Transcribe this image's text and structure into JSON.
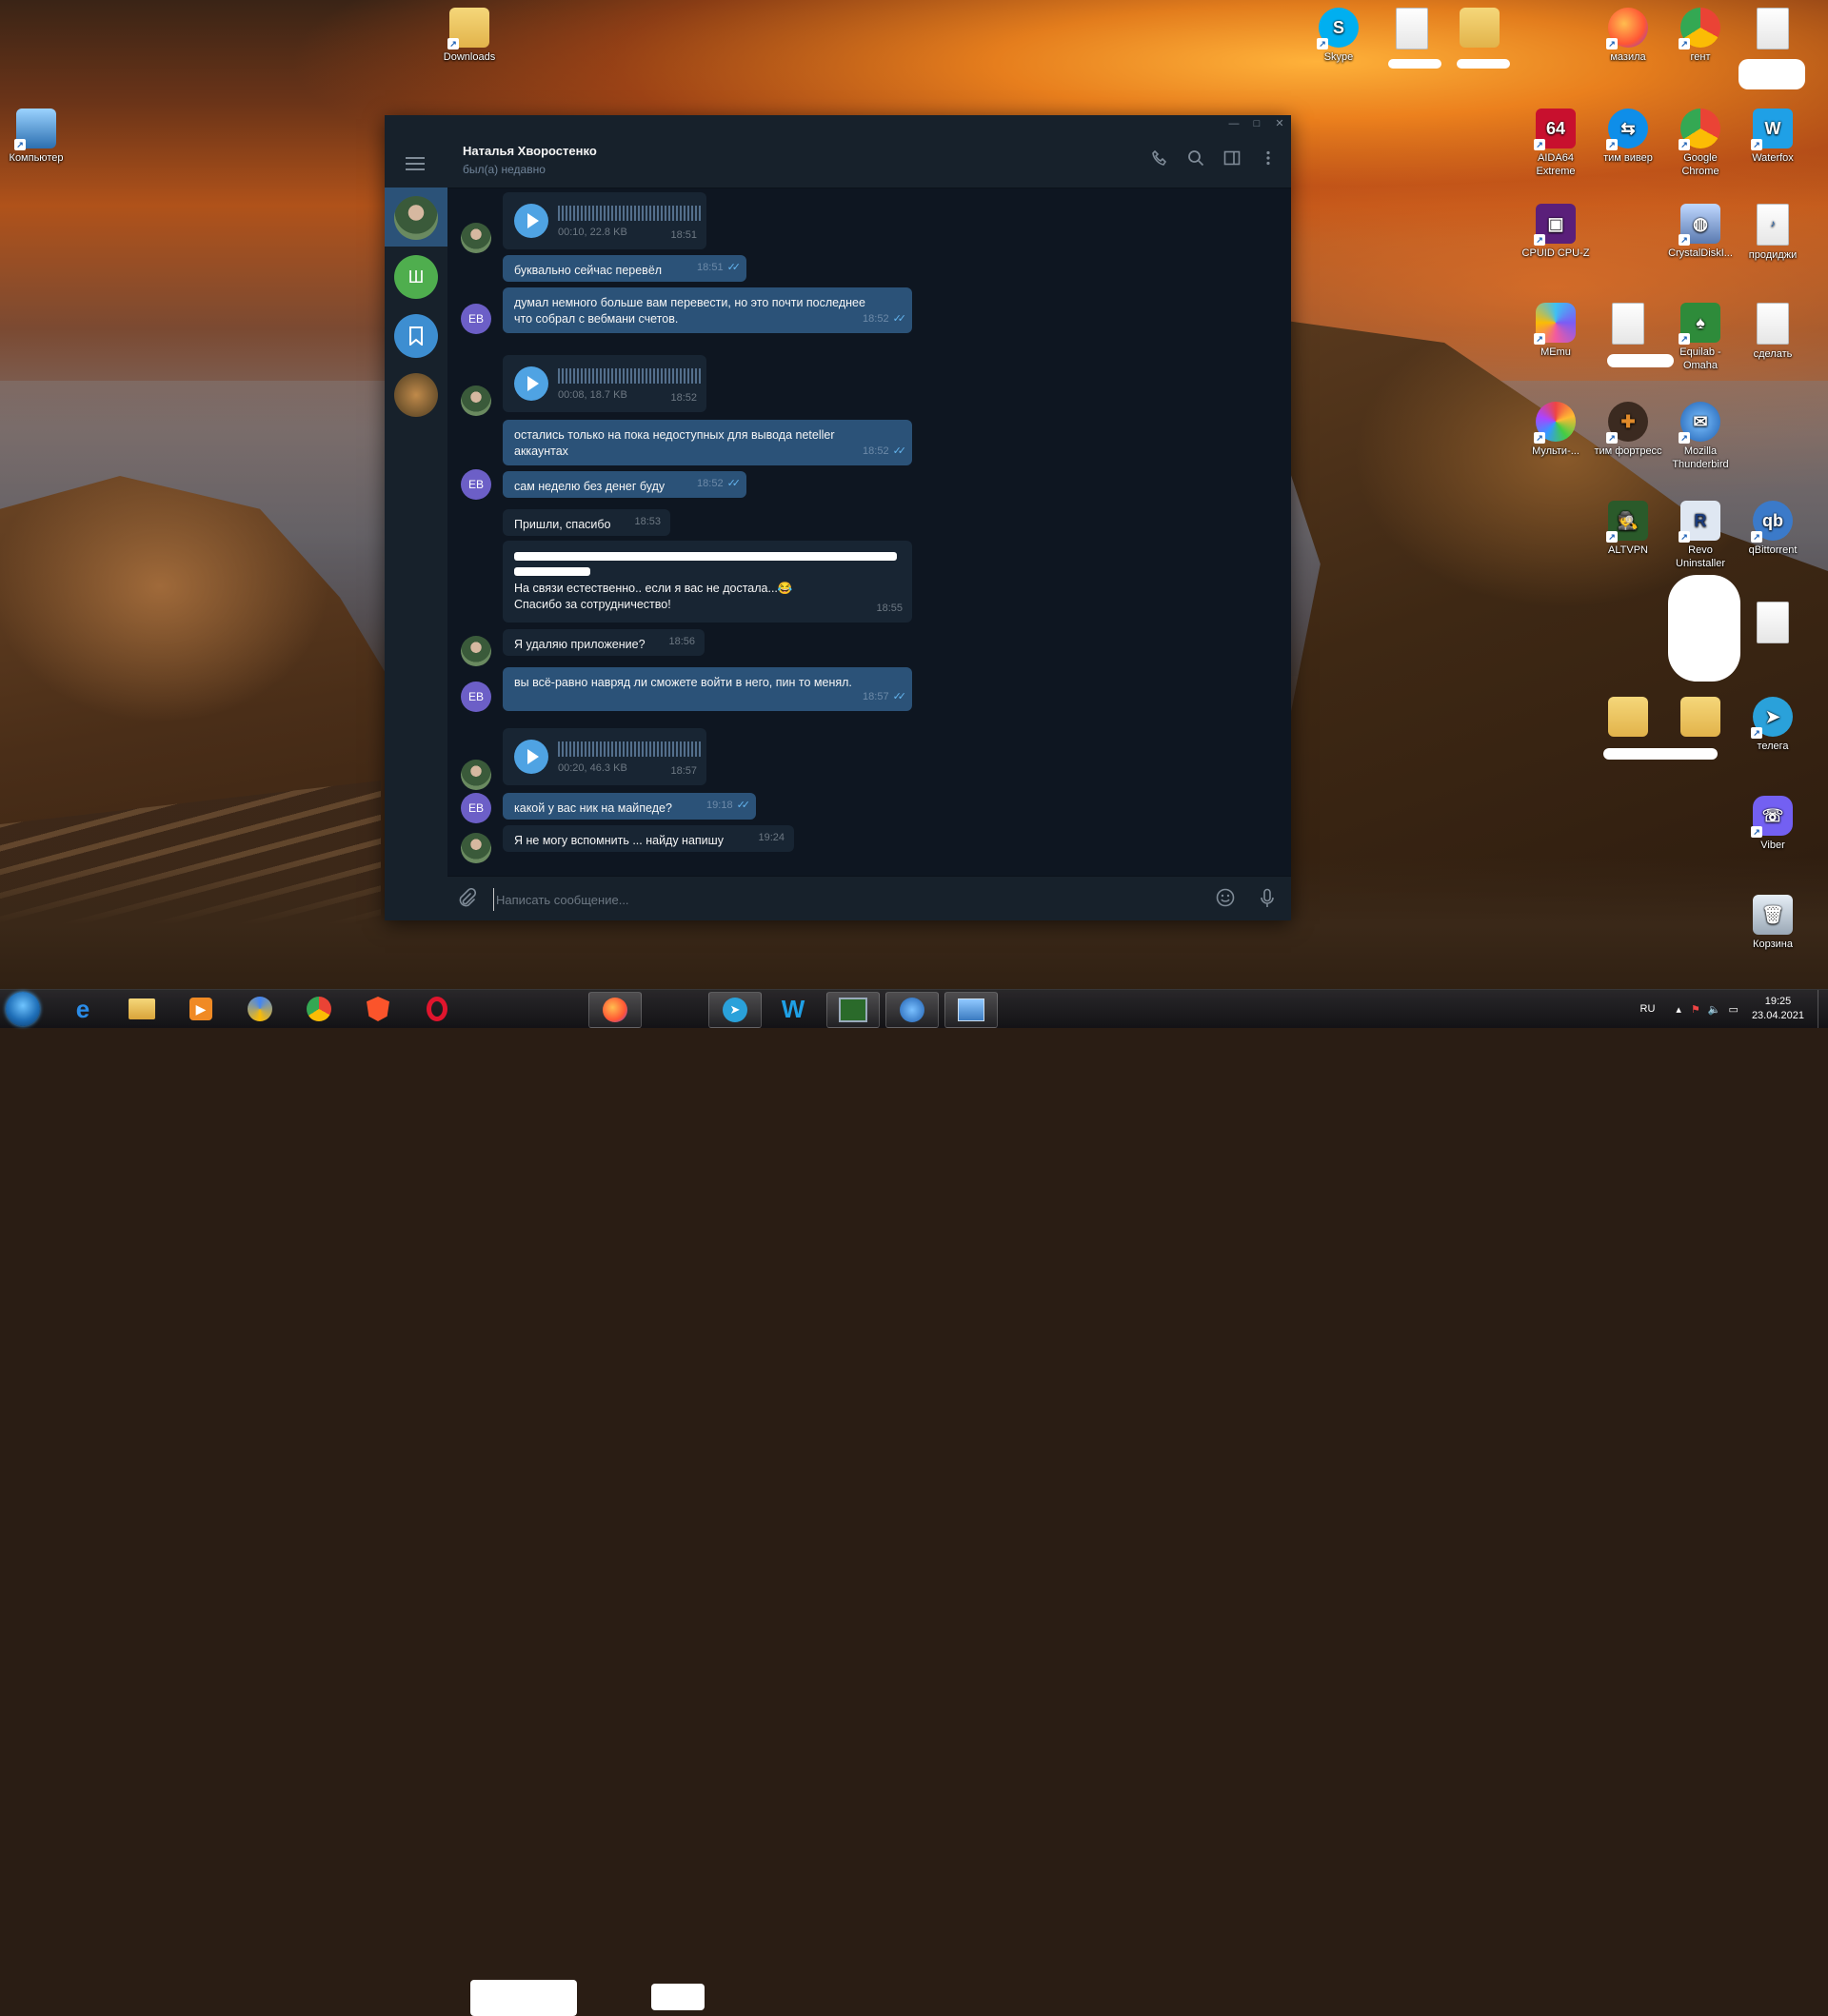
{
  "desktop": {
    "icons": [
      {
        "label": "Downloads",
        "icon": "folder-icon"
      },
      {
        "label": "Компьютер",
        "icon": "computer-icon"
      },
      {
        "label": "Skype",
        "icon": "skype-icon"
      },
      {
        "label": "мазила",
        "icon": "firefox-icon"
      },
      {
        "label": "гент",
        "icon": "chrome-icon"
      },
      {
        "label": "AIDA64 Extreme",
        "icon": "aida64-icon"
      },
      {
        "label": "тим вивер",
        "icon": "teamviewer-icon"
      },
      {
        "label": "Google Chrome",
        "icon": "chrome-icon"
      },
      {
        "label": "Waterfox",
        "icon": "waterfox-icon"
      },
      {
        "label": "CPUID CPU-Z",
        "icon": "cpuz-icon"
      },
      {
        "label": "CrystalDiskI...",
        "icon": "crystaldisk-icon"
      },
      {
        "label": "продиджи",
        "icon": "mp3-icon"
      },
      {
        "label": "MEmu",
        "icon": "memu-icon"
      },
      {
        "label": "Equilab - Omaha",
        "icon": "equilab-icon"
      },
      {
        "label": "сделать",
        "icon": "document-icon"
      },
      {
        "label": "Мульти-...",
        "icon": "multi-icon"
      },
      {
        "label": "тим фортресс",
        "icon": "tf2-icon"
      },
      {
        "label": "Mozilla Thunderbird",
        "icon": "thunderbird-icon"
      },
      {
        "label": "ALTVPN",
        "icon": "altvpn-icon"
      },
      {
        "label": "Revo Uninstaller",
        "icon": "revo-icon"
      },
      {
        "label": "qBittorrent",
        "icon": "qbittorrent-icon"
      },
      {
        "label": "телега",
        "icon": "telegram-icon"
      },
      {
        "label": "Viber",
        "icon": "viber-icon"
      },
      {
        "label": "Корзина",
        "icon": "recycle-bin-icon"
      }
    ]
  },
  "telegram": {
    "window_controls": [
      "—",
      "□",
      "✕"
    ],
    "contact_name": "Наталья Хворостенко",
    "contact_status": "был(а) недавно",
    "sidebar_chats": [
      {
        "initials": "",
        "icon": "avatar-photo"
      },
      {
        "initials": "Ш",
        "icon": "avatar-letter"
      },
      {
        "initials": "",
        "icon": "bookmark-icon"
      },
      {
        "initials": "",
        "icon": "avatar-photo"
      }
    ],
    "composer_placeholder": "Написать сообщение...",
    "messages": [
      {
        "type": "voice",
        "dir": "in",
        "meta": "00:10, 22.8 KB",
        "time": "18:51"
      },
      {
        "type": "text",
        "dir": "out",
        "text": "буквально сейчас перевёл",
        "time": "18:51"
      },
      {
        "type": "text",
        "dir": "out",
        "text": "думал немного больше вам перевести, но это почти последнее\nчто собрал с вебмани счетов.",
        "time": "18:52"
      },
      {
        "type": "voice",
        "dir": "in",
        "meta": "00:08, 18.7 KB",
        "time": "18:52"
      },
      {
        "type": "text",
        "dir": "out",
        "text": "остались только на пока недоступных для вывода neteller\nаккаунтах",
        "time": "18:52"
      },
      {
        "type": "text",
        "dir": "out",
        "text": "сам неделю без денег буду",
        "time": "18:52"
      },
      {
        "type": "text",
        "dir": "in",
        "text": "Пришли, спасибо",
        "time": "18:53"
      },
      {
        "type": "text",
        "dir": "in",
        "text": "На связи естественно.. если я вас не достала...😂\nСпасибо за сотрудничество!",
        "time": "18:55"
      },
      {
        "type": "text",
        "dir": "in",
        "text": "Я удаляю приложение?",
        "time": "18:56"
      },
      {
        "type": "text",
        "dir": "out",
        "text": "вы всё-равно навряд ли сможете войти в него, пин то менял.",
        "time": "18:57"
      },
      {
        "type": "voice",
        "dir": "in",
        "meta": "00:20, 46.3 KB",
        "time": "18:57"
      },
      {
        "type": "text",
        "dir": "out",
        "text": "какой у вас ник на майпеде?",
        "time": "19:18"
      },
      {
        "type": "text",
        "dir": "in",
        "text": "Я не могу вспомнить ... найду напишу",
        "time": "19:24"
      }
    ],
    "avatar_initials": "ЕВ"
  },
  "taskbar": {
    "lang": "RU",
    "time": "19:25",
    "date": "23.04.2021",
    "items": [
      "ie-icon",
      "explorer-icon",
      "media-player-icon",
      "chrome-canary-icon",
      "chrome-icon",
      "brave-icon",
      "opera-icon",
      "firefox-icon",
      "telegram-icon",
      "waterfox-icon",
      "task-manager-icon",
      "thunderbird-icon",
      "image-viewer-icon"
    ]
  },
  "colors": {
    "tg_bg": "#0e1621",
    "tg_panel": "#17212b",
    "bubble_out": "#2b5278",
    "bubble_in": "#182533",
    "accent": "#4fa3e3"
  }
}
